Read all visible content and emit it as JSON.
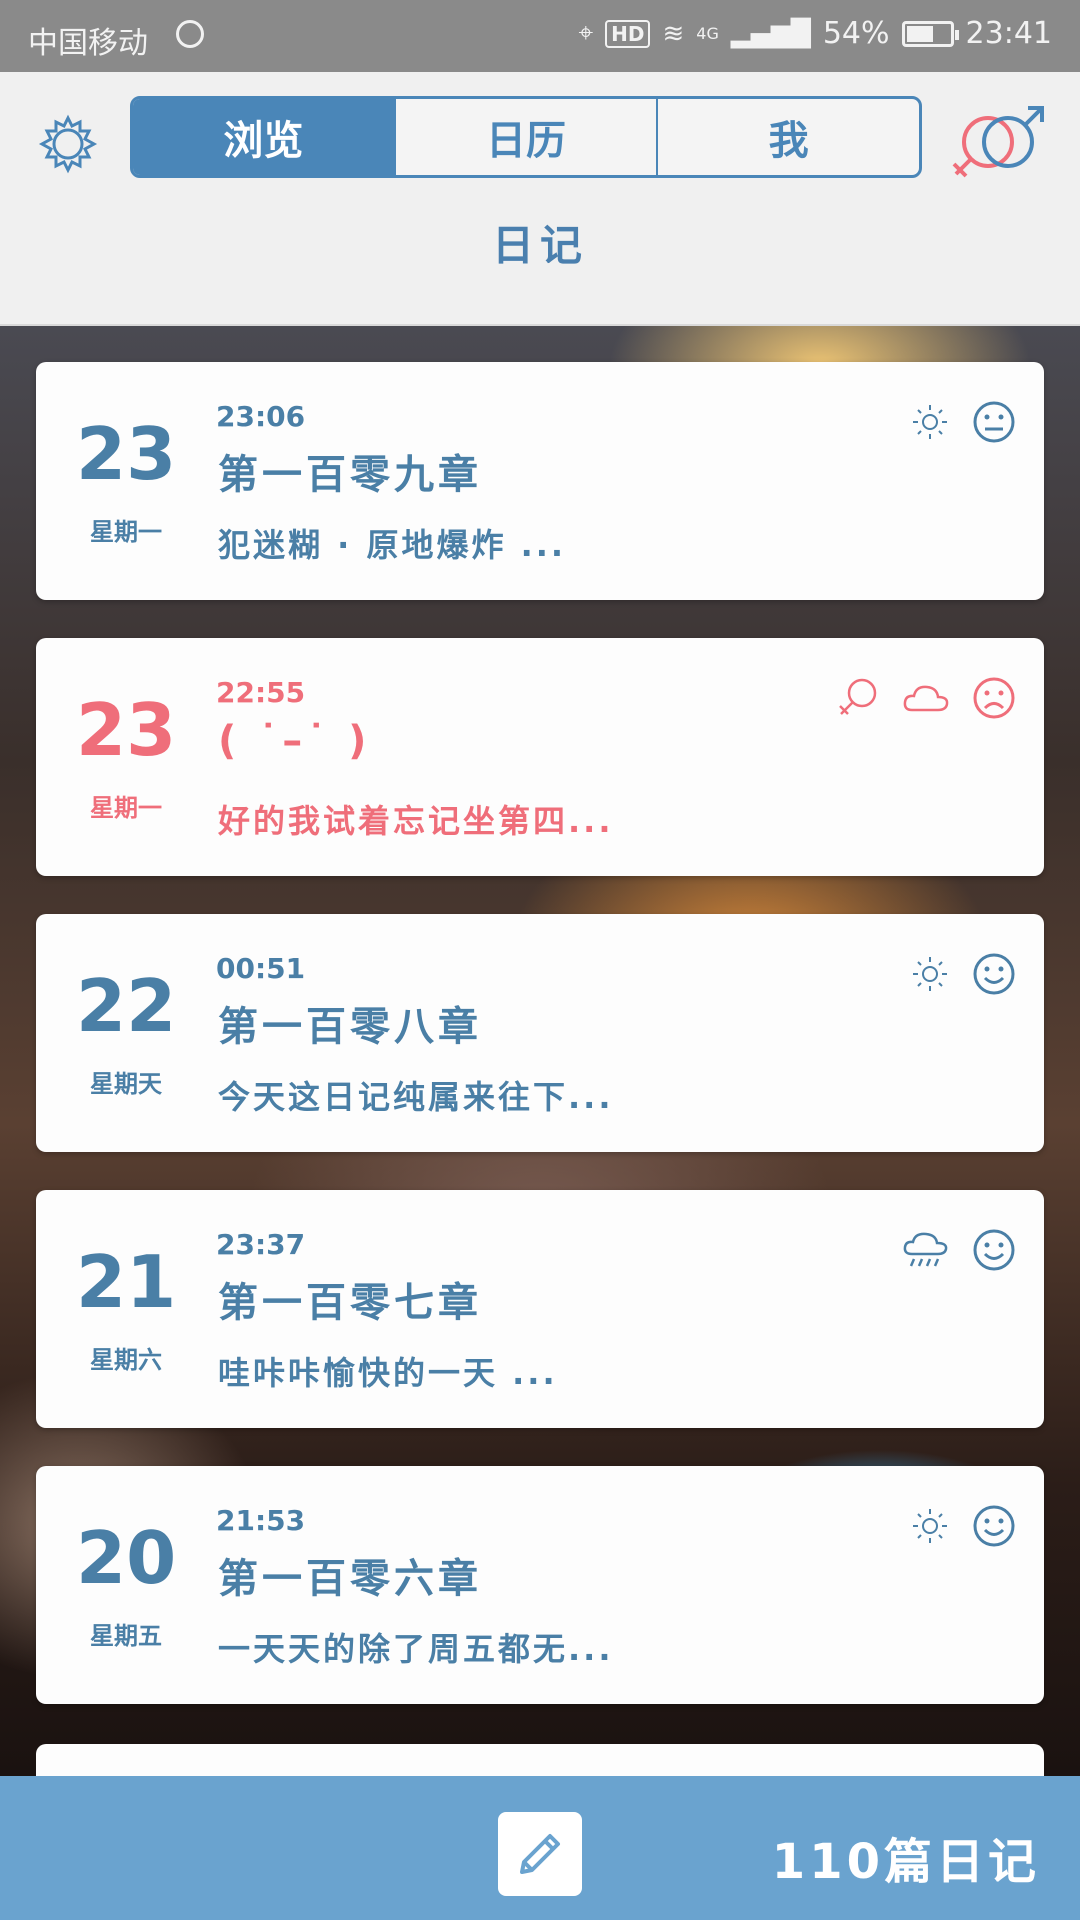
{
  "status_bar": {
    "carrier": "中国移动",
    "hd": "HD",
    "network": "4G",
    "battery": "54%",
    "battery_level": 0.54,
    "time": "23:41"
  },
  "header": {
    "tabs": [
      {
        "label": "浏览",
        "active": true
      },
      {
        "label": "日历",
        "active": false
      },
      {
        "label": "我",
        "active": false
      }
    ],
    "title": "日记"
  },
  "entries": [
    {
      "day": "23",
      "weekday": "星期一",
      "time": "23:06",
      "title": "第一百零九章",
      "excerpt": "犯迷糊 · 原地爆炸 ...",
      "style": "blue",
      "icons": [
        "sun-icon",
        "neutral-face-icon"
      ]
    },
    {
      "day": "23",
      "weekday": "星期一",
      "time": "22:55",
      "title": "( ˙–˙ )",
      "excerpt": "好的我试着忘记坐第四...",
      "style": "pink",
      "icons": [
        "female-icon",
        "cloud-icon",
        "sad-face-icon"
      ]
    },
    {
      "day": "22",
      "weekday": "星期天",
      "time": "00:51",
      "title": "第一百零八章",
      "excerpt": "今天这日记纯属来往下...",
      "style": "blue",
      "icons": [
        "sun-icon",
        "smile-face-icon"
      ]
    },
    {
      "day": "21",
      "weekday": "星期六",
      "time": "23:37",
      "title": "第一百零七章",
      "excerpt": "哇咔咔愉快的一天 ...",
      "style": "blue",
      "icons": [
        "rain-icon",
        "smile-face-icon"
      ]
    },
    {
      "day": "20",
      "weekday": "星期五",
      "time": "21:53",
      "title": "第一百零六章",
      "excerpt": "一天天的除了周五都无...",
      "style": "blue",
      "icons": [
        "sun-icon",
        "smile-face-icon"
      ]
    }
  ],
  "footer": {
    "count": "110篇日记"
  },
  "colors": {
    "blue": "#4a7fa6",
    "pink": "#ef6e7a",
    "tab_active": "#4a86b8",
    "bottom_bar": "#6aa3cf"
  }
}
